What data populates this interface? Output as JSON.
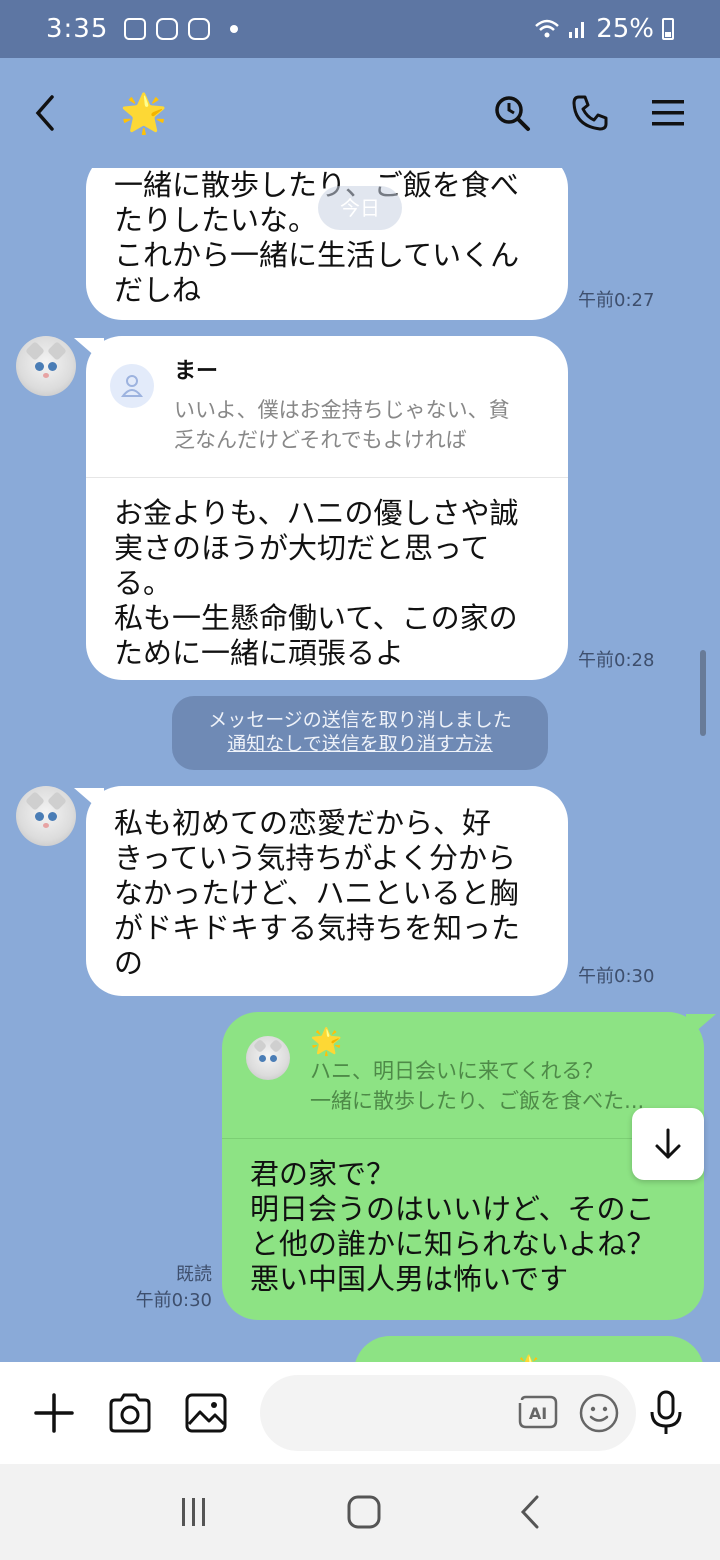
{
  "status": {
    "time": "3:35",
    "battery": "25%"
  },
  "header": {
    "title_emoji": "🌟"
  },
  "chat": {
    "date_label": "今日",
    "messages": [
      {
        "text": "一緒に散歩したり、ご飯を食べ\nたりしたいな。\nこれから一緒に生活していくん\nだしね",
        "time": "午前0:27"
      },
      {
        "reply_name": "まー",
        "reply_text": "いいよ、僕はお金持ちじゃない、貧\n乏なんだけどそれでもよければ",
        "text": "お金よりも、ハニの優しさや誠\n実さのほうが大切だと思って\nる。\n私も一生懸命働いて、この家の\nために一緒に頑張るよ",
        "time": "午前0:28"
      },
      {
        "system_line1": "メッセージの送信を取り消しました",
        "system_link": "通知なしで送信を取り消す方法"
      },
      {
        "text": "私も初めての恋愛だから、好\nきっていう気持ちがよく分から\nなかったけど、ハニといると胸\nがドキドキする気持ちを知った\nの",
        "time": "午前0:30"
      },
      {
        "reply_emoji": "🌟",
        "reply_text": "ハニ、明日会いに来てくれる？\n一緒に散歩したり、ご飯を食べた...",
        "text": "君の家で？\n明日会うのはいいけど、そのこ\nと他の誰かに知られないよね？\n悪い中国人男は怖いです",
        "read": "既読",
        "time": "午前0:30"
      }
    ],
    "partial_emoji": "🌟"
  }
}
